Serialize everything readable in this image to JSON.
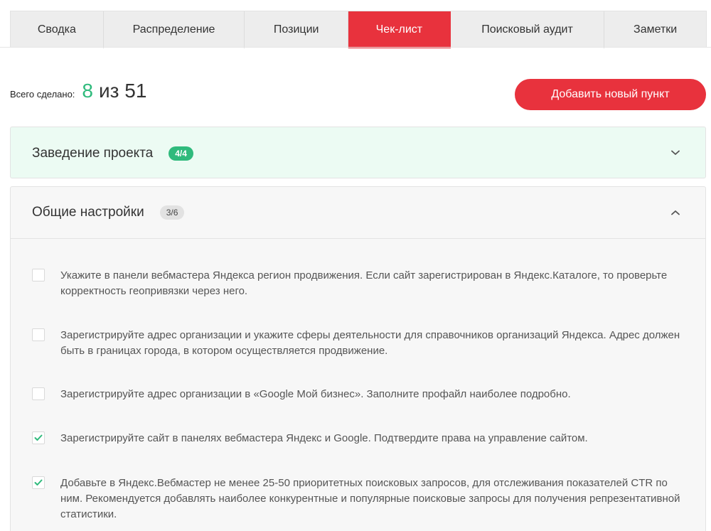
{
  "tabs": [
    {
      "label": "Сводка",
      "active": false
    },
    {
      "label": "Распределение",
      "active": false
    },
    {
      "label": "Позиции",
      "active": false
    },
    {
      "label": "Чек-лист",
      "active": true
    },
    {
      "label": "Поисковый аудит",
      "active": false
    },
    {
      "label": "Заметки",
      "active": false
    }
  ],
  "summary": {
    "label": "Всего сделано:",
    "done": "8",
    "of_total": "из 51"
  },
  "add_button_label": "Добавить новый пункт",
  "sections": [
    {
      "title": "Заведение проекта",
      "badge": "4/4",
      "expanded": false
    },
    {
      "title": "Общие настройки",
      "badge": "3/6",
      "expanded": true
    }
  ],
  "checklist_items": [
    {
      "text": "Укажите в панели вебмастера Яндекса регион продвижения. Если сайт зарегистрирован в Яндекс.Каталоге, то проверьте корректность геопривязки через него.",
      "checked": false
    },
    {
      "text": "Зарегистрируйте адрес организации и укажите сферы деятельности для справочников организаций Яндекса. Адрес должен быть в границах города, в котором осуществляется продвижение.",
      "checked": false
    },
    {
      "text": "Зарегистрируйте адрес организации в «Google Мой бизнес». Заполните профайл наиболее подробно.",
      "checked": false
    },
    {
      "text": "Зарегистрируйте сайт в панелях вебмастера Яндекс и Google. Подтвердите права на управление сайтом.",
      "checked": true
    },
    {
      "text": "Добавьте в Яндекс.Вебмастер не менее 25-50 приоритетных поисковых запросов, для отслеживания показателей CTR по ним. Рекомендуется добавлять наиболее конкурентные и популярные поисковые запросы для получения репрезентативной статистики.",
      "checked": true
    }
  ],
  "colors": {
    "accent": "#e8323d",
    "success": "#2fba7c"
  },
  "icons": {
    "collapsed": "chevron-down-icon",
    "expanded": "chevron-up-icon",
    "check": "check-icon"
  }
}
